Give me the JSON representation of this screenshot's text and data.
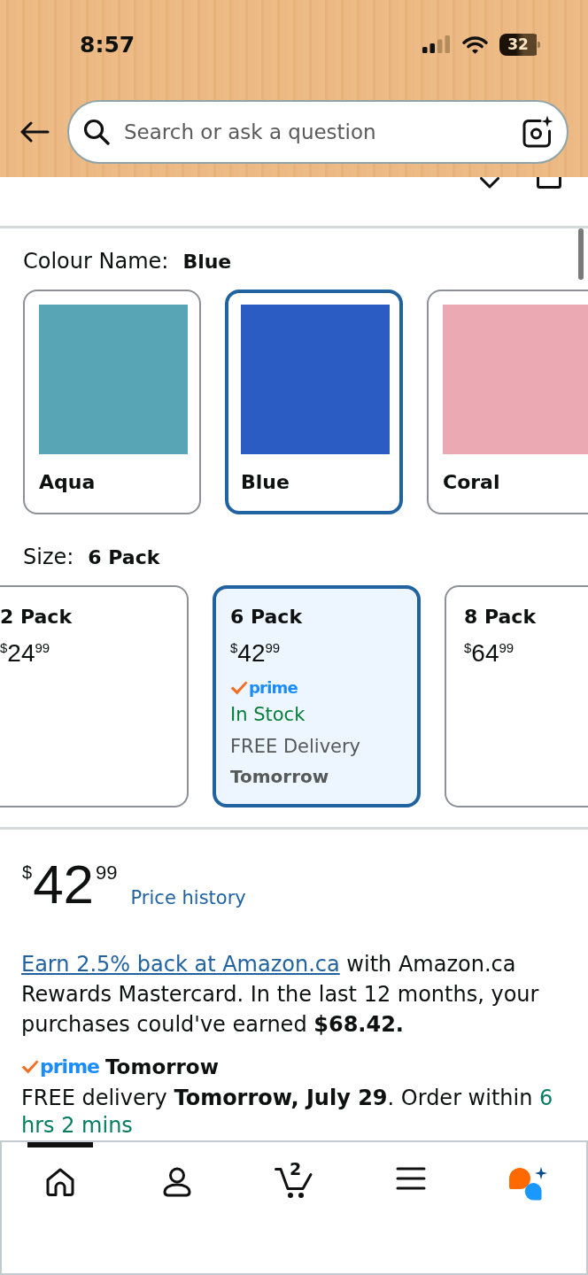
{
  "status_bar": {
    "time": "8:57",
    "battery": "32"
  },
  "search": {
    "placeholder": "Search or ask a question"
  },
  "colour": {
    "label": "Colour Name:",
    "value": "Blue",
    "options": [
      {
        "name": "Aqua",
        "color": "#58a5b6",
        "selected": false
      },
      {
        "name": "Blue",
        "color": "#2b5cc3",
        "selected": true
      },
      {
        "name": "Coral",
        "color": "#eaa9b3",
        "selected": false
      }
    ]
  },
  "size": {
    "label": "Size:",
    "value": "6 Pack",
    "options": [
      {
        "name": "2 Pack",
        "price": {
          "currency": "$",
          "whole": "24",
          "fraction": "99"
        },
        "selected": false
      },
      {
        "name": "6 Pack",
        "price": {
          "currency": "$",
          "whole": "42",
          "fraction": "99"
        },
        "selected": true,
        "prime_badge": "prime",
        "stock": "In Stock",
        "delivery": "FREE Delivery",
        "delivery_day": "Tomorrow"
      },
      {
        "name": "8 Pack",
        "price": {
          "currency": "$",
          "whole": "64",
          "fraction": "99"
        },
        "selected": false
      }
    ]
  },
  "price": {
    "currency": "$",
    "whole": "42",
    "fraction": "99",
    "history_link": "Price history"
  },
  "rewards": {
    "link": "Earn 2.5% back at Amazon.ca",
    "text": " with Amazon.ca Rewards Mastercard. In the last 12 months, your purchases could've earned **$68.42.**"
  },
  "delivery": {
    "badge": "prime",
    "headline": "Tomorrow",
    "text": "FREE delivery **Tomorrow, July 29**. Order within ",
    "countdown": "6 hrs 2 mins"
  },
  "bottom_nav": [
    {
      "kind": "home",
      "selected": true
    },
    {
      "kind": "account",
      "selected": false
    },
    {
      "kind": "cart",
      "badge": "2",
      "selected": false
    },
    {
      "kind": "menu",
      "selected": false
    },
    {
      "kind": "assistant",
      "selected": false
    }
  ]
}
